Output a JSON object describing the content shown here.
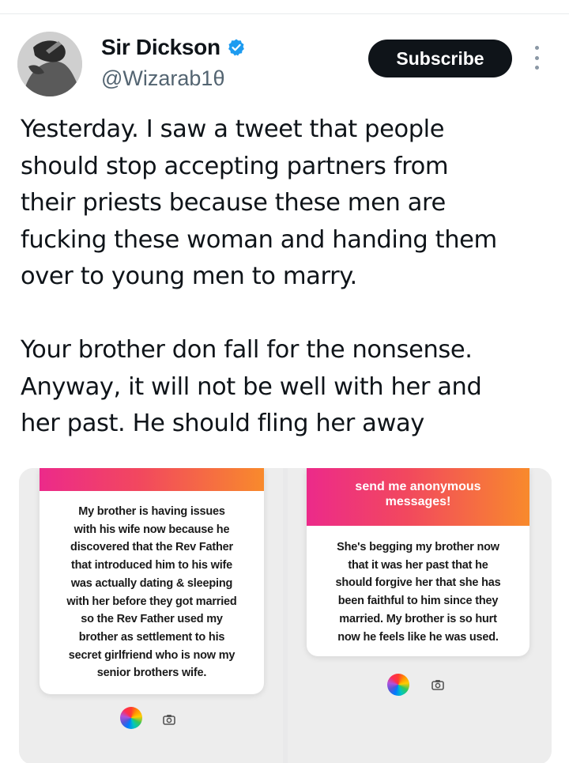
{
  "author": {
    "display_name": "Sir Dickson",
    "handle": "@Wizarab1θ",
    "verified_icon": "verified-badge-icon",
    "avatar_icon": "avatar-image"
  },
  "actions": {
    "subscribe_label": "Subscribe",
    "more_icon": "more-vertical-icon"
  },
  "tweet": {
    "paragraph1_lines": [
      "Yesterday. I saw a tweet that people",
      "should stop accepting partners from",
      "their priests because these men are",
      "fucking these woman and handing them",
      "over to young men to marry."
    ],
    "paragraph2_lines": [
      "Your brother don fall for the nonsense.",
      "Anyway, it will not be well with her and",
      "her past. He should fling her away"
    ]
  },
  "media": {
    "left_card": {
      "banner_text": "",
      "lines": [
        "My brother is having issues",
        "with his wife now because he",
        "discovered that the Rev Father",
        "that introduced him to his wife",
        "was actually dating & sleeping",
        "with her before they got married",
        "so the Rev Father used my",
        "brother as settlement to his",
        "secret girlfriend who is now my",
        "senior brothers wife."
      ]
    },
    "right_card": {
      "banner_lines": [
        "send me anonymous",
        "messages!"
      ],
      "lines": [
        "She's begging my brother now",
        "that it was her past that he",
        "should forgive her that she has",
        "been faithful to him since they",
        "married. My brother is so hurt",
        "now he feels like he was used."
      ]
    },
    "icons": [
      "color-wheel-icon",
      "camera-icon"
    ],
    "banner_colors": [
      "#ec2a8a",
      "#f2485e",
      "#f88a2c"
    ]
  }
}
